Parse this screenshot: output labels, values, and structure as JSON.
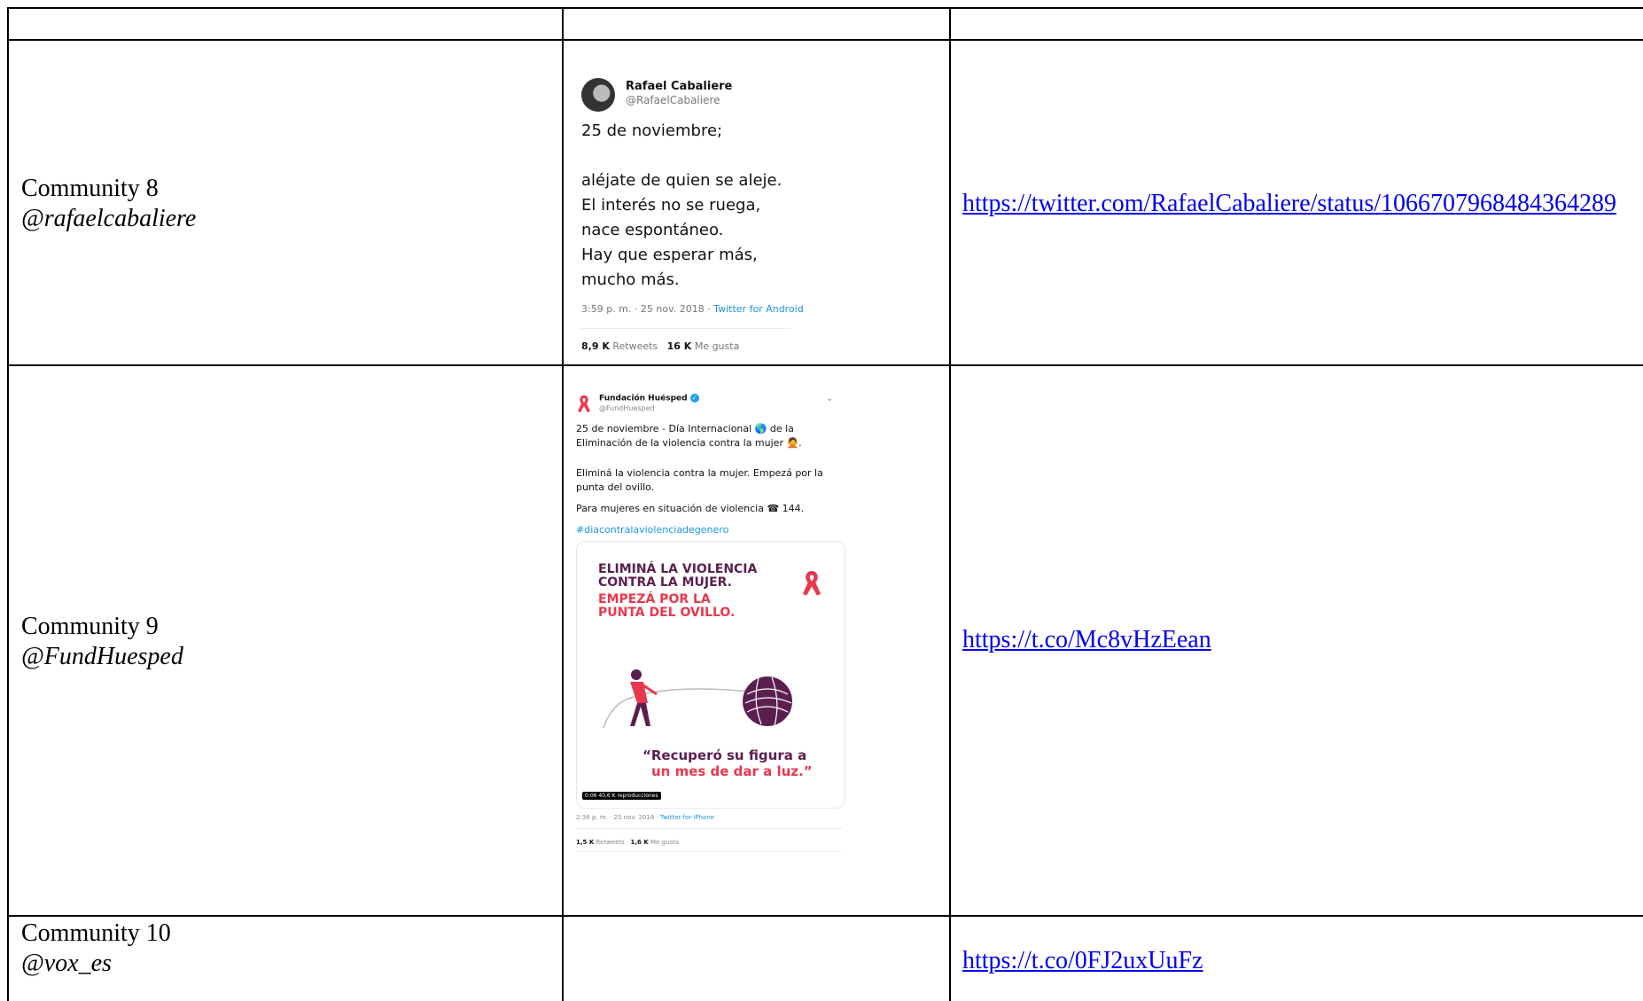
{
  "rows": [
    {
      "community": "Community 8",
      "handle": "@rafaelcabaliere",
      "link": "https://twitter.com/RafaelCabaliere/status/1066707968484364289",
      "tweet": {
        "name": "Rafael Cabaliere",
        "user": "@RafaelCabaliere",
        "text": "25 de noviembre;\n\naléjate de quien se aleje.\nEl interés no se ruega,\nnace espontáneo.\nHay que esperar más,\nmucho más.",
        "time": "3:59 p. m. · 25 nov. 2018 · ",
        "source": "Twitter for Android",
        "retweets": "8,9 K",
        "retweets_label": " Retweets",
        "likes": "16 K",
        "likes_label": " Me gusta"
      }
    },
    {
      "community": "Community 9",
      "handle": "@FundHuesped",
      "link": "https://t.co/Mc8vHzEean",
      "tweet": {
        "name": "Fundación Huésped",
        "user": "@FundHuesped",
        "p1": "25 de noviembre - Día Internacional 🌎 de la Eliminación de la violencia contra la mujer 🙅.",
        "p2": "Eliminá la violencia contra la mujer. Empezá por la punta del ovillo.",
        "p3": "Para mujeres en situación de violencia ☎ 144.",
        "hashtag": "#diacontralaviolenciadegenero",
        "card_h1": "ELIMINÁ LA VIOLENCIA CONTRA LA MUJER.",
        "card_h2": "EMPEZÁ POR LA PUNTA DEL OVILLO.",
        "quote1": "“Recuperó su figura a",
        "quote2": "un mes de dar a luz.”",
        "video_badge": "0:06  40,6 K reproducciones",
        "time": "2:36 p. m. · 25 nov. 2018 · ",
        "source": "Twitter for iPhone",
        "retweets": "1,5 K",
        "retweets_label": " Retweets",
        "likes": "1,6 K",
        "likes_label": " Me gusta"
      }
    },
    {
      "community": "Community 10",
      "handle": "@vox_es",
      "link": "https://t.co/0FJ2uxUuFz"
    }
  ],
  "colors": {
    "link": "#0000ee",
    "brand_purple": "#5b1f4f",
    "brand_red": "#e8384f",
    "twitter_blue": "#1b95e0"
  }
}
